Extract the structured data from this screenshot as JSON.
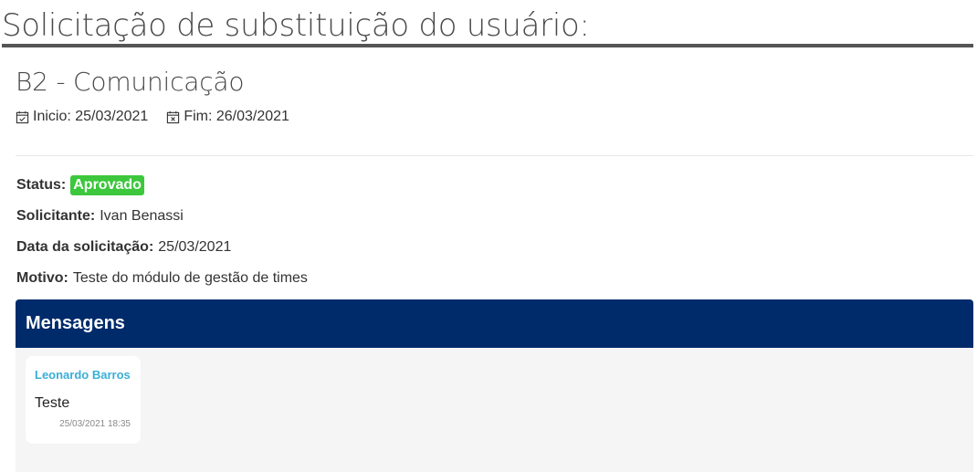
{
  "page_title": "Solicitação de substituição do usuário:",
  "team": {
    "name": "B2 - Comunicação",
    "start_label": "Inicio: 25/03/2021",
    "end_label": "Fim: 26/03/2021"
  },
  "details": {
    "status_label": "Status:",
    "status_value": "Aprovado",
    "status_color": "#3cc73c",
    "requester_label": "Solicitante:",
    "requester_value": "Ivan Benassi",
    "request_date_label": "Data da solicitação:",
    "request_date_value": "25/03/2021",
    "reason_label": "Motivo:",
    "reason_value": "Teste do módulo de gestão de times"
  },
  "messages": {
    "header": "Mensagens",
    "header_color": "#002b6b",
    "items": [
      {
        "author": "Leonardo Barros",
        "text": "Teste",
        "timestamp": "25/03/2021 18:35"
      }
    ]
  },
  "icons": {
    "start": "calendar-check-icon",
    "end": "calendar-x-icon"
  }
}
